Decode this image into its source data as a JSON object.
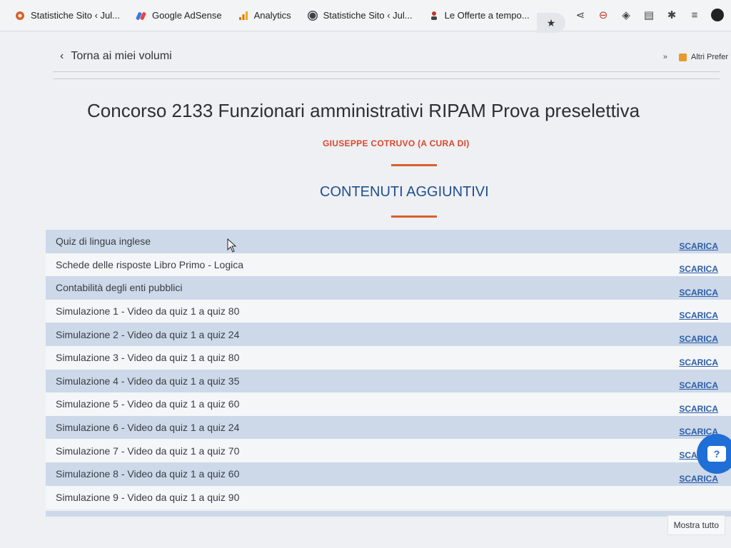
{
  "browser": {
    "bookmarks": [
      {
        "icon": "gear-icon",
        "label": "Statistiche Sito ‹ Jul..."
      },
      {
        "icon": "adsense-icon",
        "label": "Google AdSense"
      },
      {
        "icon": "analytics-icon",
        "label": "Analytics"
      },
      {
        "icon": "wordpress-icon",
        "label": "Statistiche Sito ‹ Jul..."
      },
      {
        "icon": "offer-icon",
        "label": "Le Offerte a tempo..."
      }
    ],
    "more": "»",
    "other_bookmarks": "Altri Prefer"
  },
  "page": {
    "back_label": "Torna ai miei volumi",
    "title": "Concorso 2133 Funzionari amministrativi RIPAM Prova preselettiva",
    "author": "GIUSEPPE COTRUVO (A CURA DI)",
    "section_title": "CONTENUTI AGGIUNTIVI",
    "download_label": "SCARICA",
    "items": [
      "Quiz di lingua inglese",
      "Schede delle risposte Libro Primo - Logica",
      "Contabilità degli enti pubblici",
      "Simulazione 1 - Video da quiz 1 a quiz 80",
      "Simulazione 2 - Video da quiz 1 a quiz 24",
      "Simulazione 3 - Video da quiz 1 a quiz 80",
      "Simulazione 4 - Video da quiz 1 a quiz 35",
      "Simulazione 5 - Video da quiz 1 a quiz 60",
      "Simulazione 6 - Video da quiz 1 a quiz 24",
      "Simulazione 7 - Video da quiz 1 a quiz 70",
      "Simulazione 8 - Video da quiz 1 a quiz 60",
      "Simulazione 9 - Video da quiz 1 a quiz 90"
    ],
    "show_all": "Mostra tutto",
    "help_glyph": "?"
  },
  "colors": {
    "accent": "#d9602b",
    "author": "#d9472b",
    "section_title": "#1f4f8f",
    "row_shade": "#cdd9e9",
    "link": "#2d5da8"
  }
}
